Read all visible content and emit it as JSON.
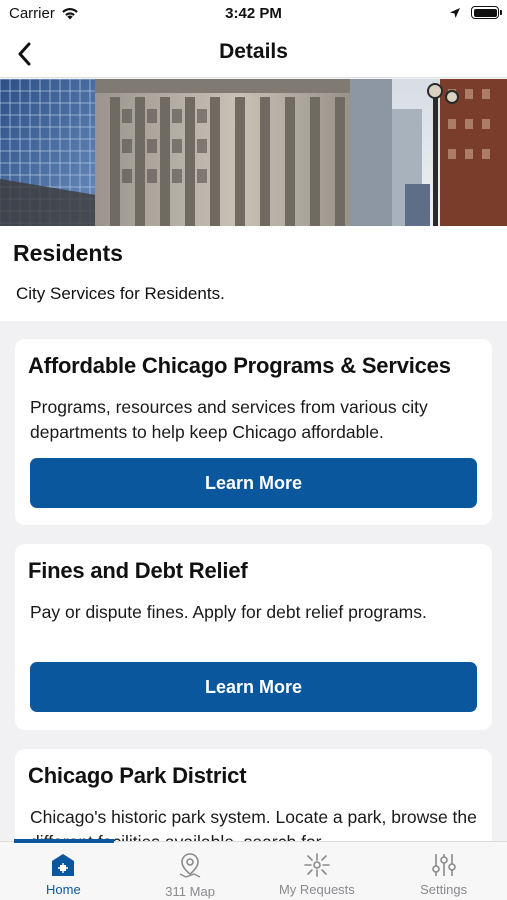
{
  "status_bar": {
    "carrier": "Carrier",
    "time": "3:42 PM"
  },
  "nav": {
    "title": "Details"
  },
  "intro": {
    "title": "Residents",
    "subtitle": "City Services for Residents."
  },
  "cards": [
    {
      "title": "Affordable Chicago Programs & Services",
      "description": "Programs, resources and services from various city departments to help keep Chicago affordable.",
      "button_label": "Learn More"
    },
    {
      "title": "Fines and Debt Relief",
      "description": "Pay or dispute fines.  Apply for debt relief programs.",
      "button_label": "Learn More"
    },
    {
      "title": "Chicago Park District",
      "description": "Chicago's historic park system. Locate a park, browse the different facilities available, search for"
    }
  ],
  "tabs": [
    {
      "label": "Home",
      "icon": "home-icon",
      "active": true
    },
    {
      "label": "311 Map",
      "icon": "map-pin-icon",
      "active": false
    },
    {
      "label": "My Requests",
      "icon": "requests-icon",
      "active": false
    },
    {
      "label": "Settings",
      "icon": "sliders-icon",
      "active": false
    }
  ],
  "colors": {
    "accent": "#0b579e",
    "tab_inactive": "#8a8a8e"
  }
}
